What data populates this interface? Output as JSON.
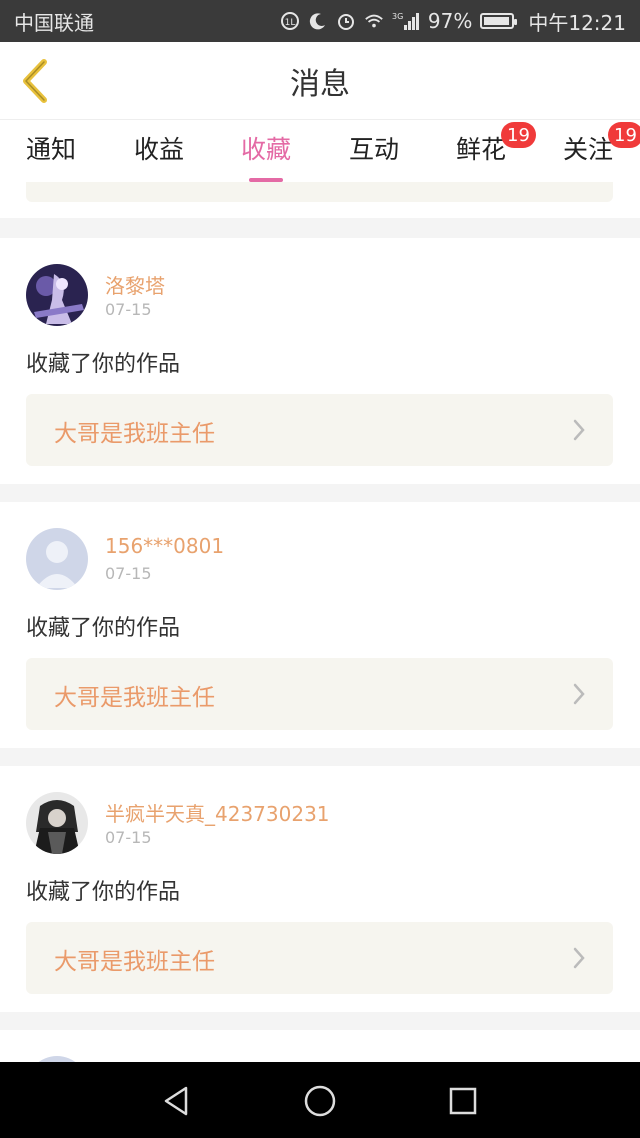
{
  "status": {
    "carrier": "中国联通",
    "signal_label": "3G",
    "battery": "97%",
    "battery_level": 0.97,
    "time": "中午12:21"
  },
  "header": {
    "title": "消息"
  },
  "tabs": [
    {
      "label": "通知"
    },
    {
      "label": "收益"
    },
    {
      "label": "收藏",
      "active": true
    },
    {
      "label": "互动"
    },
    {
      "label": "鲜花",
      "badge": "19"
    },
    {
      "label": "关注",
      "badge": "19"
    }
  ],
  "items": [
    {
      "user": "洛黎塔",
      "date": "07-15",
      "action": "收藏了你的作品",
      "work_title": "大哥是我班主任"
    },
    {
      "user": "156***0801",
      "date": "07-15",
      "action": "收藏了你的作品",
      "work_title": "大哥是我班主任"
    },
    {
      "user": "半疯半天真_423730231",
      "date": "07-15",
      "action": "收藏了你的作品",
      "work_title": "大哥是我班主任"
    }
  ],
  "colors": {
    "accent": "#e46aa5",
    "username": "#e8a26e",
    "work_title": "#ea9a6a",
    "badge": "#f03a3a",
    "back_arrow": "#e8c13c"
  }
}
